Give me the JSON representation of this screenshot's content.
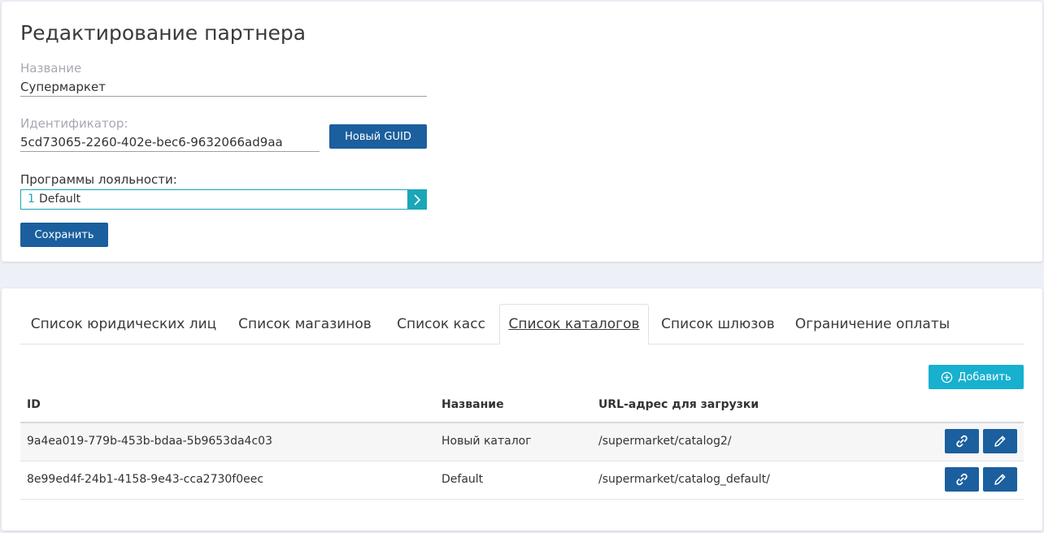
{
  "form": {
    "title": "Редактирование партнера",
    "name_label": "Название",
    "name_value": "Супермаркет",
    "id_label": "Идентификатор:",
    "id_value": "5cd73065-2260-402e-bec6-9632066ad9aa",
    "new_guid_label": "Новый GUID",
    "loyalty_label": "Программы лояльности:",
    "loyalty_selected_num": "1",
    "loyalty_selected_text": "Default",
    "save_label": "Сохранить"
  },
  "tabs": [
    {
      "label": "Список юридических лиц",
      "active": false
    },
    {
      "label": "Список магазинов",
      "active": false
    },
    {
      "label": "Список касс",
      "active": false
    },
    {
      "label": "Список каталогов",
      "active": true
    },
    {
      "label": "Список шлюзов",
      "active": false
    },
    {
      "label": "Ограничение оплаты",
      "active": false
    }
  ],
  "catalogs": {
    "add_label": "Добавить",
    "columns": [
      "ID",
      "Название",
      "URL-адрес для загрузки"
    ],
    "rows": [
      {
        "id": "9a4ea019-779b-453b-bdaa-5b9653da4c03",
        "name": "Новый каталог",
        "url": "/supermarket/catalog2/"
      },
      {
        "id": "8e99ed4f-24b1-4158-9e43-cca2730f0eec",
        "name": "Default",
        "url": "/supermarket/catalog_default/"
      }
    ]
  },
  "icons": {
    "chevron": "chevron-right-icon",
    "add": "plus-circle-icon",
    "link": "link-icon",
    "edit": "pencil-icon"
  },
  "colors": {
    "primary": "#1b5f9e",
    "accent": "#17b0cf",
    "select_border": "#1ba6b8"
  }
}
